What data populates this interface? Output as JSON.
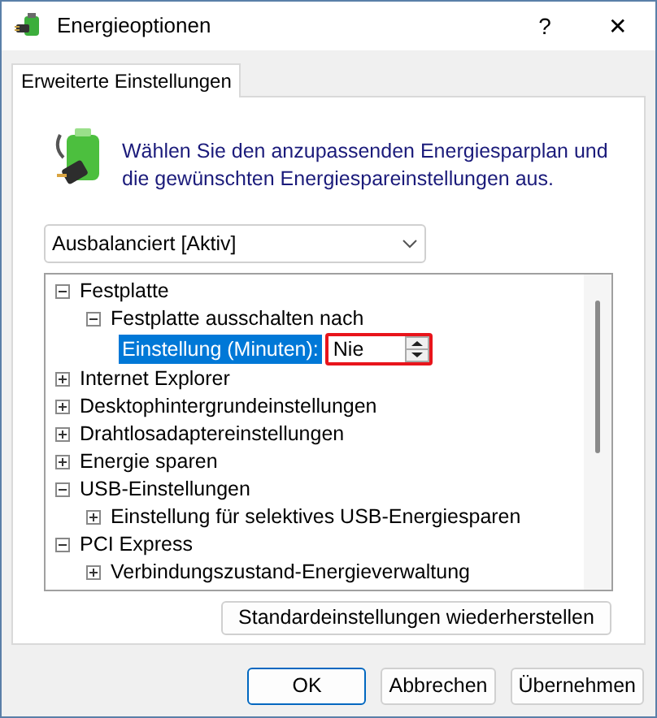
{
  "window": {
    "title": "Energieoptionen",
    "help": "?",
    "close": "✕"
  },
  "tabs": [
    {
      "label": "Erweiterte Einstellungen",
      "selected": true
    }
  ],
  "intro": "Wählen Sie den anzupassenden Energiesparplan und die gewünschten Energiespareinstellungen aus.",
  "plan_dropdown": {
    "value": "Ausbalanciert [Aktiv]"
  },
  "tree": [
    {
      "label": "Festplatte",
      "expanded": true,
      "children": [
        {
          "label": "Festplatte ausschalten nach",
          "expanded": true,
          "children": [
            {
              "kind": "setting",
              "label": "Einstellung (Minuten):",
              "selected": true,
              "value": "Nie",
              "highlighted": true
            }
          ]
        }
      ]
    },
    {
      "label": "Internet Explorer",
      "expanded": false
    },
    {
      "label": "Desktophintergrundeinstellungen",
      "expanded": false
    },
    {
      "label": "Drahtlosadaptereinstellungen",
      "expanded": false
    },
    {
      "label": "Energie sparen",
      "expanded": false
    },
    {
      "label": "USB-Einstellungen",
      "expanded": true,
      "children": [
        {
          "label": "Einstellung für selektives USB-Energiesparen",
          "expanded": false
        }
      ]
    },
    {
      "label": "PCI Express",
      "expanded": true,
      "children": [
        {
          "label": "Verbindungszustand-Energieverwaltung",
          "expanded": false
        }
      ]
    }
  ],
  "restore_button": "Standardeinstellungen wiederherstellen",
  "buttons": [
    {
      "label": "OK",
      "default": true
    },
    {
      "label": "Abbrechen",
      "default": false
    },
    {
      "label": "Übernehmen",
      "default": false
    }
  ]
}
